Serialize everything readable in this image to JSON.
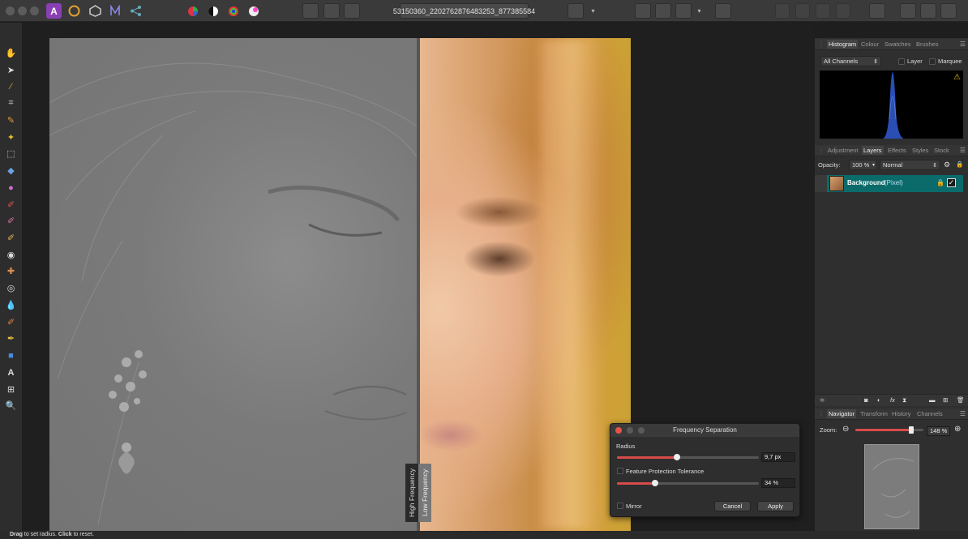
{
  "window": {
    "document_name": "53150360_2202762876483253_877385584"
  },
  "split_view": {
    "left_label": "High Frequency",
    "right_label": "Low Frequency"
  },
  "histogram_panel": {
    "tabs": [
      "Histogram",
      "Colour",
      "Swatches",
      "Brushes"
    ],
    "channel_select": "All Channels",
    "layer_label": "Layer",
    "marquee_label": "Marquee",
    "warning_icon": "warning-icon"
  },
  "layers_panel": {
    "tabs": [
      "Adjustment",
      "Layers",
      "Effects",
      "Styles",
      "Stock"
    ],
    "opacity_label": "Opacity:",
    "opacity_value": "100 %",
    "blend_mode": "Normal",
    "layer_name": "Background",
    "layer_type": "(Pixel)",
    "selection_color": "#0b6b6b"
  },
  "navigator_panel": {
    "tabs": [
      "Navigator",
      "Transform",
      "History",
      "Channels"
    ],
    "zoom_label": "Zoom:",
    "zoom_value": "148 %",
    "zoom_level": 0.82
  },
  "dialog": {
    "title": "Frequency Separation",
    "radius_label": "Radius",
    "radius_value": "9,7 px",
    "radius_level": 0.42,
    "feature_label": "Feature Protection Tolerance",
    "feature_value": "34 %",
    "feature_level": 0.27,
    "mirror_label": "Mirror",
    "cancel_label": "Cancel",
    "apply_label": "Apply"
  },
  "status": {
    "drag": "Drag",
    "drag_text": " to set radius. ",
    "click": "Click",
    "click_text": " to reset."
  },
  "colors": {
    "accent": "#d84b4b",
    "panel_bg": "#2f2f2f"
  }
}
